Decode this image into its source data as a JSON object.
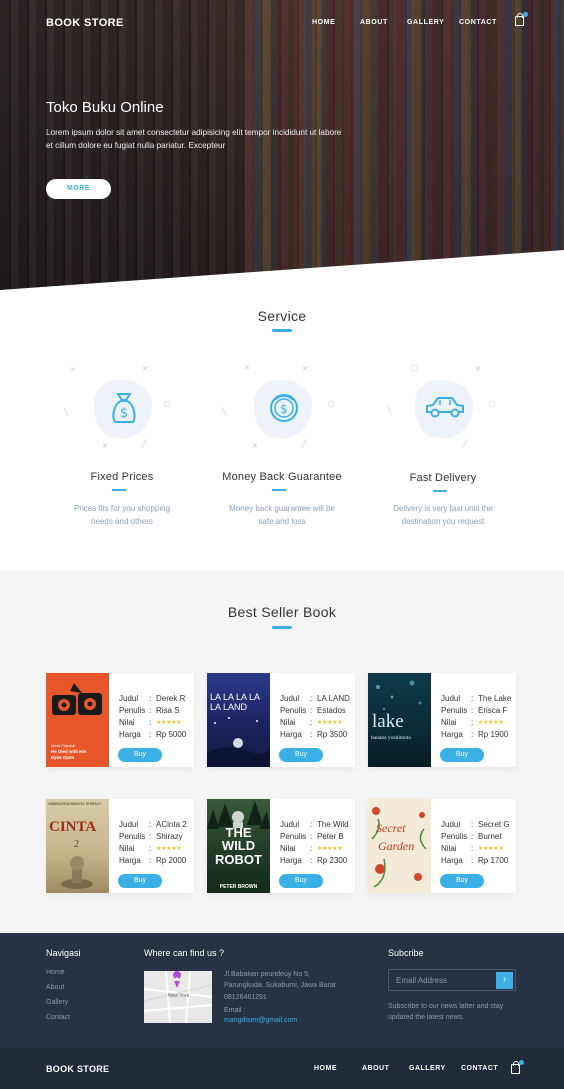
{
  "nav": {
    "brand": "BOOK STORE",
    "links": [
      "HOME",
      "ABOUT",
      "GALLERY",
      "CONTACT"
    ],
    "cart_icon": "shopping-bag-icon"
  },
  "hero": {
    "title": "Toko Buku Online",
    "text": "Lorem ipsum dolor sit amet consectetur adipisicing elit tempor incididunt ut labore et cillum dolore eu fugiat nulla pariatur. Excepteur",
    "button": "MORE"
  },
  "service": {
    "title": "Service",
    "items": [
      {
        "title": "Fixed Prices",
        "text": "Prices fits for you shopping needs and others",
        "icon": "money-bag-icon"
      },
      {
        "title": "Money Back Guarantee",
        "text": "Money back guarantee will be safe and loss",
        "icon": "money-back-icon"
      },
      {
        "title": "Fast Delivery",
        "text": "Delivery is very fast until the destination you request",
        "icon": "car-icon"
      }
    ]
  },
  "bestseller": {
    "title": "Best Seller Book",
    "labels": {
      "judul": "Judul",
      "penulis": "Penulis",
      "nilai": "Nilai",
      "harga": "Harga",
      "sep": ":",
      "buy": "Buy"
    },
    "books": [
      {
        "judul": "Derek R",
        "penulis": "Risa S",
        "rating": "★★★★★",
        "harga": "Rp 5000",
        "cover_lines": [
          "Derek Rojewski",
          "He Died with His",
          "Eyes Open"
        ]
      },
      {
        "judul": "LA LAND",
        "penulis": "Estados",
        "rating": "★★★★★",
        "harga": "Rp 3500",
        "cover_lines": [
          "LA LA LA LA",
          "LA LAND"
        ]
      },
      {
        "judul": "The Lake",
        "penulis": "Erisca F",
        "rating": "★★★★★",
        "harga": "Rp 1900",
        "cover_lines": [
          "lake",
          "banana yoshimoto"
        ]
      },
      {
        "judul": "ACinta 2",
        "penulis": "Shirazy",
        "rating": "★★★★★",
        "harga": "Rp 2000",
        "cover_lines": [
          "HABIBURRAHMAN EL SHIRAZY",
          "CINTA",
          "2"
        ]
      },
      {
        "judul": "The Wild",
        "penulis": "Peter B",
        "rating": "★★★★★",
        "harga": "Rp 2300",
        "cover_lines": [
          "THE",
          "WILD",
          "ROBOT",
          "PETER BROWN"
        ]
      },
      {
        "judul": "Secret G",
        "penulis": "Burnet",
        "rating": "★★★★★",
        "harga": "Rp 1700",
        "cover_lines": [
          "Secret",
          "Garden"
        ]
      }
    ]
  },
  "footer": {
    "nav_title": "Navigasi",
    "nav_links": [
      "Home",
      "About",
      "Gallery",
      "Contact"
    ],
    "where_title": "Where can find us ?",
    "map_label": "New York",
    "address": "Jl.Babakan peundeuy No 5, Parungkuda, Sukabumi, Jawa Barat",
    "phone": "08126461291",
    "email_label": "Email :",
    "email": "mangdisen@gmail.com",
    "subscribe_title": "Subcribe",
    "email_placeholder": "Email Address",
    "subscribe_text": "Subscribe to our news latter and stay updated the latest news."
  },
  "footbar": {
    "brand": "BOOK STORE",
    "links": [
      "HOME",
      "ABOUT",
      "GALLERY",
      "CONTACT"
    ]
  },
  "colors": {
    "accent": "#3ab0e6",
    "footer": "#273245",
    "star": "#f5c01a"
  }
}
